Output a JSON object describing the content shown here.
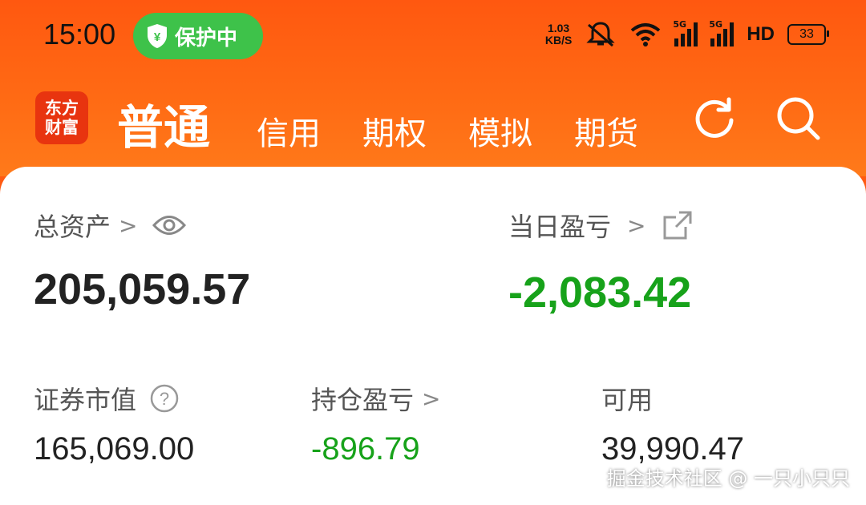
{
  "colors": {
    "brand": "#ff5a12",
    "green_value": "#17a21a",
    "text_dark": "#222222",
    "protect_green": "#3ec24a"
  },
  "status_bar": {
    "time": "15:00",
    "protect_label": "保护中",
    "net_speed_value": "1.03",
    "net_speed_unit": "KB/S",
    "signal1_label": "5G",
    "signal2_label": "5G",
    "hd_label": "HD",
    "battery": "33",
    "icons": [
      "shield-yen-icon",
      "mute-bell-icon",
      "wifi-icon",
      "signal-icon",
      "battery-icon"
    ]
  },
  "nav": {
    "logo_line1": "东方",
    "logo_line2": "财富",
    "tabs": [
      "普通",
      "信用",
      "期权",
      "模拟",
      "期货"
    ],
    "active_tab": "普通",
    "icons": [
      "refresh-icon",
      "search-icon"
    ]
  },
  "account": {
    "total_assets_label": "总资产",
    "total_assets_value": "205,059.57",
    "daily_pl_label": "当日盈亏",
    "daily_pl_value": "-2,083.42",
    "market_value_label": "证券市值",
    "market_value_value": "165,069.00",
    "position_pl_label": "持仓盈亏",
    "position_pl_value": "-896.79",
    "available_label": "可用",
    "available_value": "39,990.47"
  },
  "watermark": "掘金技术社区 @ 一只小只只"
}
